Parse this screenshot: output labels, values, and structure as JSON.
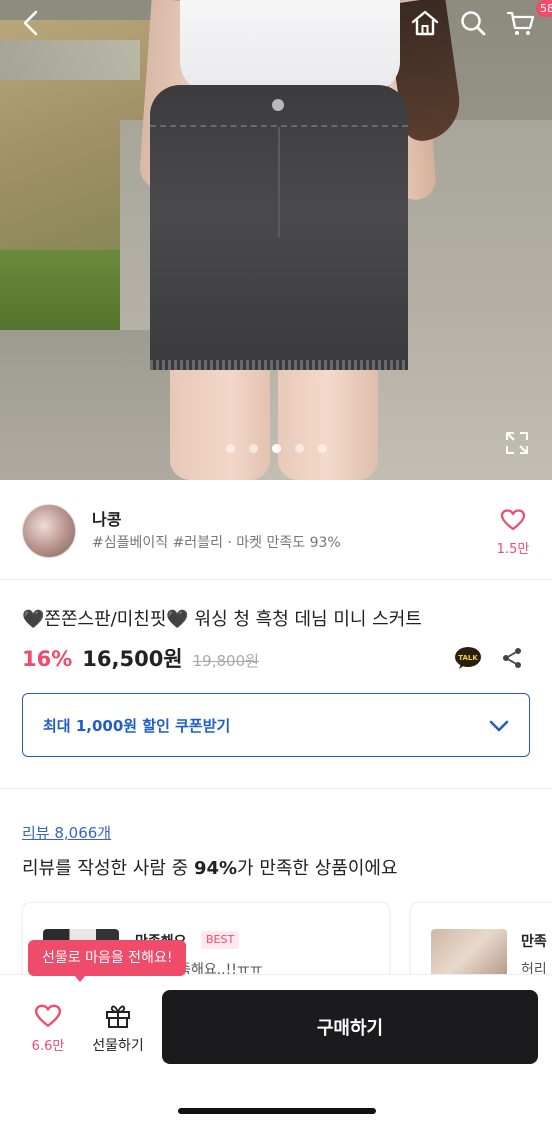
{
  "header": {
    "icons": [
      "back-icon",
      "home-icon",
      "search-icon",
      "cart-icon"
    ],
    "cart_count": "58"
  },
  "carousel": {
    "total_images": 5,
    "current_index": 3
  },
  "seller": {
    "name": "나콩",
    "tags": "#심플베이직 #러블리 · 마켓 만족도 93%",
    "like_count": "1.5만"
  },
  "product": {
    "title": "🖤쫀쫀스판/미친핏🖤 워싱 청 흑청 데님 미니 스커트",
    "discount": "16%",
    "price": "16,500원",
    "original_price": "19,800원"
  },
  "coupon": {
    "label": "최대 1,000원 할인 쿠폰받기"
  },
  "reviews": {
    "count_label": "리뷰 8,066개",
    "summary_prefix": "리뷰를 작성한 사람 중 ",
    "summary_percent": "94%",
    "summary_suffix": "가 만족한 상품이에요",
    "cards": [
      {
        "title": "만족해요",
        "badge": "BEST",
        "body": "너무 만족해요..!!ㅠㅠ"
      },
      {
        "title": "만족",
        "body": "허리"
      }
    ]
  },
  "bottom_bar": {
    "gift_tooltip": "선물로 마음을 전해요!",
    "like_count": "6.6만",
    "gift_label": "선물하기",
    "buy_label": "구매하기"
  },
  "colors": {
    "accent_pink": "#ef4b6a",
    "coupon_blue": "#1f5ec9",
    "buy_button": "#1b1b1d"
  }
}
